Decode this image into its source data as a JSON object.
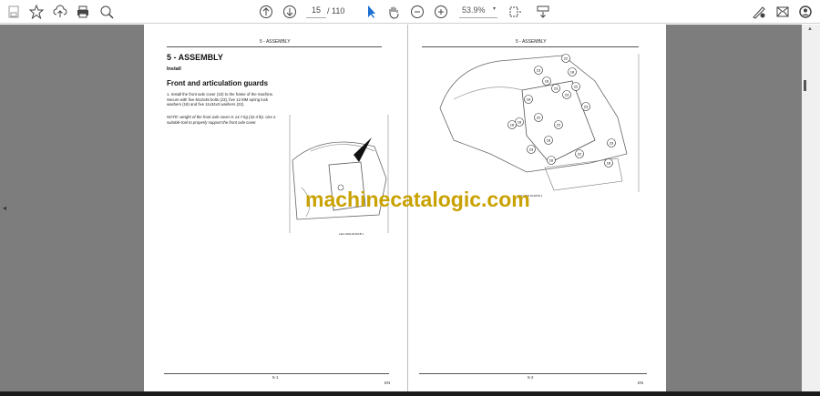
{
  "toolbar": {
    "page_current": "15",
    "page_total": "/ 110",
    "zoom": "53.9%"
  },
  "page_left": {
    "header": "5 - ASSEMBLY",
    "title": "5 - ASSEMBLY",
    "subtitle": "Install",
    "section": "Front and articulation guards",
    "step": "1. Install the front axle cover (10) to the frame of the machine. Secure with five M12x45 bolts (23), five 12 MM spring lock washers (18) and five 11x34x3 washers (22).",
    "note": "NOTE: weight of the front axle cover is 14.7 kg (32.4 lb). Use a suitable tool to properly support the front axle cover.",
    "caption": "LEIL19WH1196FB  1",
    "footer_page": "5-1",
    "footer_lang": "EN"
  },
  "page_right": {
    "header": "5 - ASSEMBLY",
    "caption": "LEIL19WH1198FB  2",
    "callouts": [
      "23",
      "18",
      "22",
      "23",
      "18",
      "22",
      "18",
      "23",
      "22",
      "18",
      "16",
      "22",
      "23",
      "18",
      "23",
      "18",
      "22",
      "23",
      "16"
    ],
    "footer_page": "5-2",
    "footer_lang": "EN"
  },
  "watermark": "machinecatalogic.com"
}
